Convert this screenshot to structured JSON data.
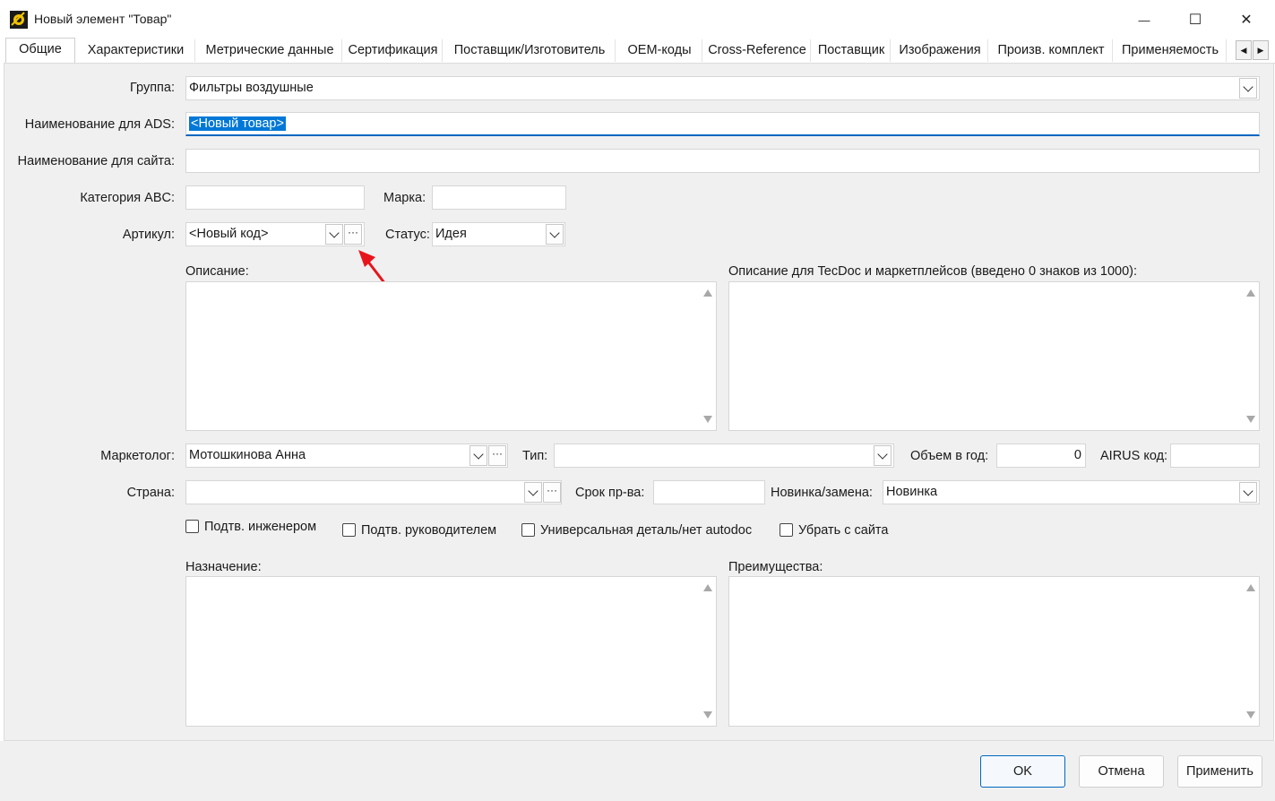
{
  "window": {
    "title": "Новый элемент \"Товар\"",
    "minimize": "—",
    "maximize": "☐",
    "close": "✕"
  },
  "tabs": [
    {
      "label": "Общие"
    },
    {
      "label": "Характеристики"
    },
    {
      "label": "Метрические данные"
    },
    {
      "label": "Сертификация"
    },
    {
      "label": "Поставщик/Изготовитель"
    },
    {
      "label": "OEM-коды"
    },
    {
      "label": "Cross-Reference"
    },
    {
      "label": "Поставщик"
    },
    {
      "label": "Изображения"
    },
    {
      "label": "Произв. комплект"
    },
    {
      "label": "Применяемость"
    }
  ],
  "form": {
    "group_label": "Группа:",
    "group_value": "Фильтры воздушные",
    "ads_name_label": "Наименование для ADS:",
    "ads_name_value": "<Новый товар>",
    "site_name_label": "Наименование для сайта:",
    "site_name_value": "",
    "abc_label": "Категория ABC:",
    "abc_value": "",
    "brand_label": "Марка:",
    "brand_value": "",
    "article_label": "Артикул:",
    "article_value": "<Новый код>",
    "status_label": "Статус:",
    "status_value": "Идея",
    "description_label": "Описание:",
    "tecdoc_label": "Описание для TecDoc и маркетплейсов (введено 0 знаков из 1000):",
    "marketer_label": "Маркетолог:",
    "marketer_value": "Мотошкинова Анна",
    "type_label": "Тип:",
    "type_value": "",
    "volume_label": "Объем в год:",
    "volume_value": "0",
    "airus_label": "AIRUS код:",
    "airus_value": "",
    "country_label": "Страна:",
    "country_value": "",
    "lead_time_label": "Срок пр-ва:",
    "lead_time_value": "",
    "novelty_label": "Новинка/замена:",
    "novelty_value": "Новинка",
    "checkboxes": [
      {
        "label": "Подтв. инженером",
        "checked": false
      },
      {
        "label": "Подтв. руководителем",
        "checked": false
      },
      {
        "label": "Универсальная деталь/нет autodoc",
        "checked": false
      },
      {
        "label": "Убрать с сайта",
        "checked": false
      }
    ],
    "purpose_label": "Назначение:",
    "advantages_label": "Преимущества:",
    "dots": "···"
  },
  "buttons": {
    "ok": "OK",
    "cancel": "Отмена",
    "apply": "Применить"
  },
  "colors": {
    "accent": "#0078d7",
    "annotation_arrow": "#e8141b"
  }
}
